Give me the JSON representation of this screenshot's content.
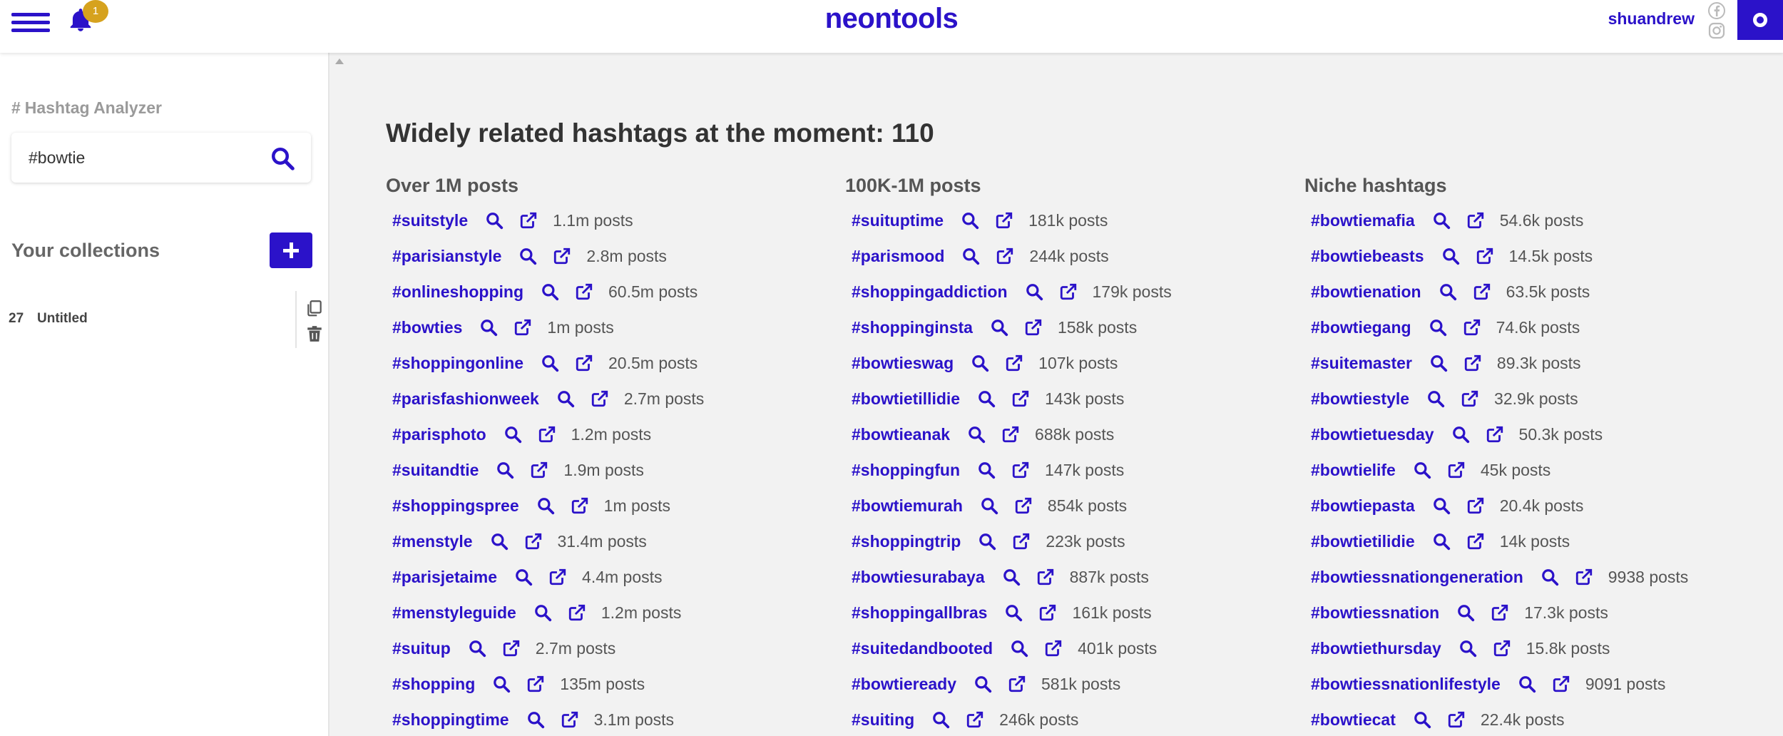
{
  "header": {
    "logo": "neontools",
    "notification_count": "1",
    "username": "shuandrew"
  },
  "sidebar": {
    "analyzer_title": "Hashtag Analyzer",
    "search_value": "#bowtie",
    "collections_title": "Your collections",
    "collections": [
      {
        "count": "27",
        "name": "Untitled"
      }
    ]
  },
  "main": {
    "title": "Widely related hashtags at the moment: 110",
    "columns": [
      {
        "heading": "Over 1M posts",
        "tags": [
          {
            "tag": "#suitstyle",
            "posts": "1.1m posts"
          },
          {
            "tag": "#parisianstyle",
            "posts": "2.8m posts"
          },
          {
            "tag": "#onlineshopping",
            "posts": "60.5m posts"
          },
          {
            "tag": "#bowties",
            "posts": "1m posts"
          },
          {
            "tag": "#shoppingonline",
            "posts": "20.5m posts"
          },
          {
            "tag": "#parisfashionweek",
            "posts": "2.7m posts"
          },
          {
            "tag": "#parisphoto",
            "posts": "1.2m posts"
          },
          {
            "tag": "#suitandtie",
            "posts": "1.9m posts"
          },
          {
            "tag": "#shoppingspree",
            "posts": "1m posts"
          },
          {
            "tag": "#menstyle",
            "posts": "31.4m posts"
          },
          {
            "tag": "#parisjetaime",
            "posts": "4.4m posts"
          },
          {
            "tag": "#menstyleguide",
            "posts": "1.2m posts"
          },
          {
            "tag": "#suitup",
            "posts": "2.7m posts"
          },
          {
            "tag": "#shopping",
            "posts": "135m posts"
          },
          {
            "tag": "#shoppingtime",
            "posts": "3.1m posts"
          }
        ]
      },
      {
        "heading": "100K-1M posts",
        "tags": [
          {
            "tag": "#suituptime",
            "posts": "181k posts"
          },
          {
            "tag": "#parismood",
            "posts": "244k posts"
          },
          {
            "tag": "#shoppingaddiction",
            "posts": "179k posts"
          },
          {
            "tag": "#shoppinginsta",
            "posts": "158k posts"
          },
          {
            "tag": "#bowtieswag",
            "posts": "107k posts"
          },
          {
            "tag": "#bowtietillidie",
            "posts": "143k posts"
          },
          {
            "tag": "#bowtieanak",
            "posts": "688k posts"
          },
          {
            "tag": "#shoppingfun",
            "posts": "147k posts"
          },
          {
            "tag": "#bowtiemurah",
            "posts": "854k posts"
          },
          {
            "tag": "#shoppingtrip",
            "posts": "223k posts"
          },
          {
            "tag": "#bowtiesurabaya",
            "posts": "887k posts"
          },
          {
            "tag": "#shoppingallbras",
            "posts": "161k posts"
          },
          {
            "tag": "#suitedandbooted",
            "posts": "401k posts"
          },
          {
            "tag": "#bowtieready",
            "posts": "581k posts"
          },
          {
            "tag": "#suiting",
            "posts": "246k posts"
          }
        ]
      },
      {
        "heading": "Niche hashtags",
        "tags": [
          {
            "tag": "#bowtiemafia",
            "posts": "54.6k posts"
          },
          {
            "tag": "#bowtiebeasts",
            "posts": "14.5k posts"
          },
          {
            "tag": "#bowtienation",
            "posts": "63.5k posts"
          },
          {
            "tag": "#bowtiegang",
            "posts": "74.6k posts"
          },
          {
            "tag": "#suitemaster",
            "posts": "89.3k posts"
          },
          {
            "tag": "#bowtiestyle",
            "posts": "32.9k posts"
          },
          {
            "tag": "#bowtietuesday",
            "posts": "50.3k posts"
          },
          {
            "tag": "#bowtielife",
            "posts": "45k posts"
          },
          {
            "tag": "#bowtiepasta",
            "posts": "20.4k posts"
          },
          {
            "tag": "#bowtietilidie",
            "posts": "14k posts"
          },
          {
            "tag": "#bowtiessnationgeneration",
            "posts": "9938 posts"
          },
          {
            "tag": "#bowtiessnation",
            "posts": "17.3k posts"
          },
          {
            "tag": "#bowtiethursday",
            "posts": "15.8k posts"
          },
          {
            "tag": "#bowtiessnationlifestyle",
            "posts": "9091 posts"
          },
          {
            "tag": "#bowtiecat",
            "posts": "22.4k posts"
          }
        ]
      }
    ]
  },
  "colors": {
    "accent": "#2b12c9",
    "badge": "#d6a21e"
  },
  "icons": {
    "search": "search-icon",
    "open": "external-link-icon",
    "bell": "bell-icon",
    "menu": "hamburger-icon",
    "add": "plus-icon",
    "copy": "copy-icon",
    "delete": "trash-icon"
  }
}
